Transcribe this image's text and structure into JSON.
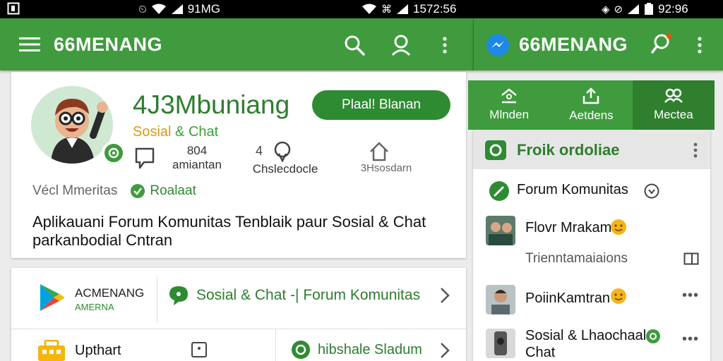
{
  "status_bar": {
    "left_time": "91MG",
    "center_time": "1572:56",
    "right_time": "92:96"
  },
  "app_bar": {
    "left_title": "66MENANG",
    "right_title": "66MENANG"
  },
  "profile": {
    "app_name": "4J3Mbuniang",
    "tag_part1": "Sosial",
    "tag_part2": "& Chat",
    "install_label": "Plaal! Blanan",
    "stats": [
      {
        "line1": "804",
        "line2": "amiantan"
      },
      {
        "line1": "",
        "line2": "Chslecdocle"
      },
      {
        "line1": "",
        "line2": "3Hsosdarn"
      }
    ],
    "meta_left": "Vécl Mmeritas",
    "meta_right": "Roalaat",
    "description": "Aplikauani Forum Komunitas Tenblaik paur Sosial & Chat parkanbodial Cntran"
  },
  "row_card": {
    "store_name": "ACMENANG",
    "store_sub": "AMERNA",
    "link1_label": "Sosial & Chat -| Forum Komunitas",
    "item2_label": "Upthart",
    "link2_label": "hibshale Sladum"
  },
  "right_tabs": [
    {
      "label": "Mlnden"
    },
    {
      "label": "Aetdens"
    },
    {
      "label": "Mectea"
    }
  ],
  "side_panel": {
    "header_title": "Froik ordoliae",
    "forum_label": "Forum Komunitas",
    "items": [
      {
        "title": "Flovr Mrakam",
        "sub": "Trienntamaiaions"
      },
      {
        "title": "PoiinKamtran"
      },
      {
        "title": "Sosial & Lhaochaal Chat"
      }
    ]
  },
  "colors": {
    "brand_green": "#3f9b3d",
    "dark_green": "#2e7d2f",
    "accent_orange": "#d99a12"
  }
}
